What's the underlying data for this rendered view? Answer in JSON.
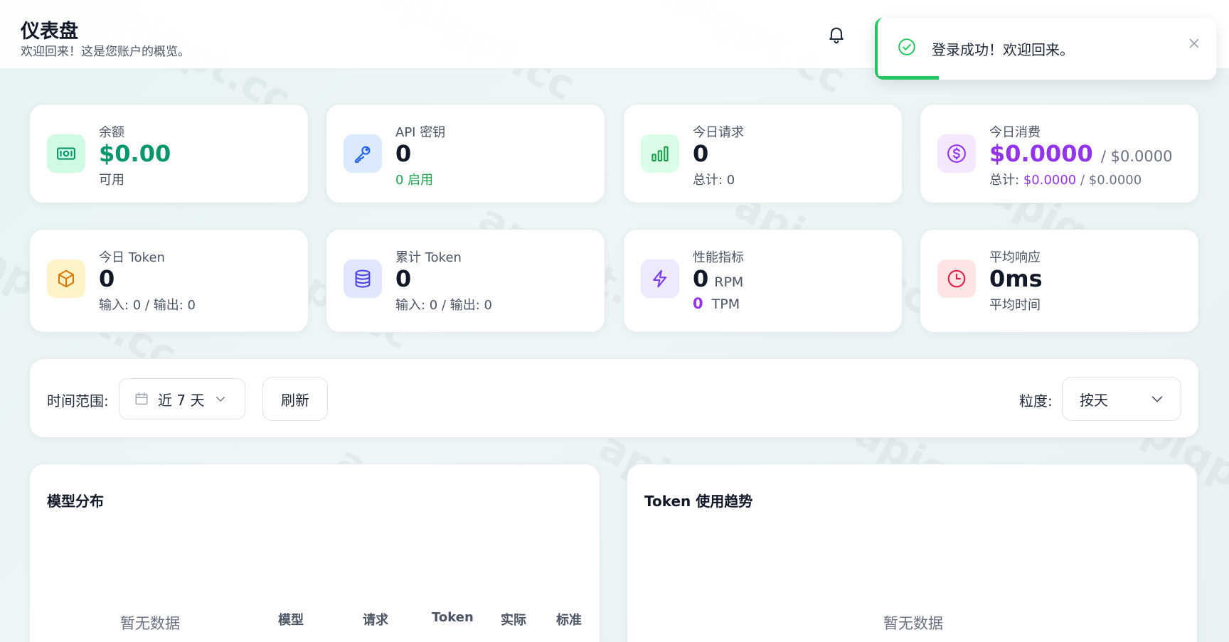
{
  "header": {
    "title": "仪表盘",
    "subtitle": "欢迎回来！这是您账户的概览。"
  },
  "toast": {
    "message": "登录成功！欢迎回来。",
    "progress_fraction": 0.18,
    "color": "#22c55e"
  },
  "stats": [
    {
      "label": "余额",
      "value": "$0.00",
      "sub": "可用",
      "icon": "money-icon"
    },
    {
      "label": "API 密钥",
      "value": "0",
      "sub": "0 启用",
      "icon": "key-icon"
    },
    {
      "label": "今日请求",
      "value": "0",
      "sub": "总计: 0",
      "icon": "bar-chart-icon"
    },
    {
      "label": "今日消费",
      "value": "$0.0000",
      "value_ext": "/ $0.0000",
      "sub_prefix": "总计:",
      "sub_value": "$0.0000",
      "sub_ext": "/ $0.0000",
      "icon": "dollar-circle-icon"
    },
    {
      "label": "今日 Token",
      "value": "0",
      "sub": "输入: 0 / 输出: 0",
      "icon": "cube-icon"
    },
    {
      "label": "累计 Token",
      "value": "0",
      "sub": "输入: 0 / 输出: 0",
      "icon": "database-icon"
    },
    {
      "label": "性能指标",
      "value": "0",
      "value_unit": "RPM",
      "sub_value": "0",
      "sub_unit": "TPM",
      "icon": "lightning-icon"
    },
    {
      "label": "平均响应",
      "value": "0ms",
      "sub": "平均时间",
      "icon": "clock-icon"
    }
  ],
  "filters": {
    "time_range_label": "时间范围:",
    "time_range_value": "近 7 天",
    "refresh_label": "刷新",
    "granularity_label": "粒度:",
    "granularity_value": "按天"
  },
  "model_distribution": {
    "title": "模型分布",
    "empty": "暂无数据",
    "columns": [
      "模型",
      "请求",
      "Token",
      "实际",
      "标准"
    ]
  },
  "token_trend": {
    "title": "Token 使用趋势",
    "empty": "暂无数据"
  },
  "watermark": "apigpt.cc",
  "colors": {
    "accent_green": "#059669",
    "accent_purple": "#9333ea",
    "success": "#22c55e"
  }
}
